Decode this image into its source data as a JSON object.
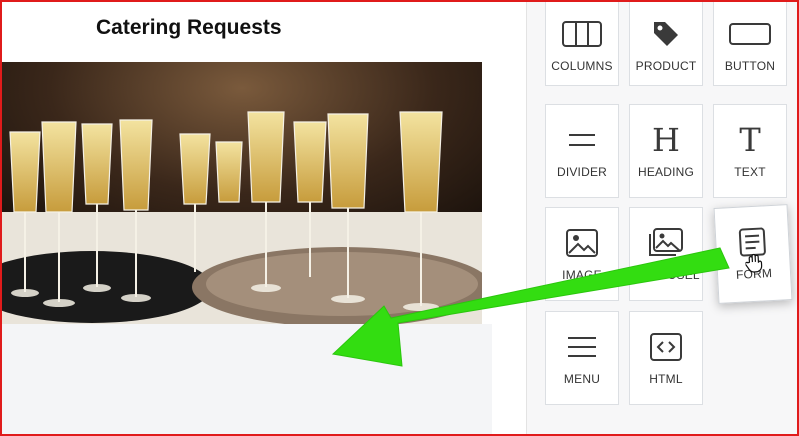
{
  "canvas": {
    "title": "Catering Requests",
    "photo_alt": "Champagne flutes on serving trays"
  },
  "blocks": [
    {
      "label": "COLUMNS",
      "icon": "columns-icon"
    },
    {
      "label": "PRODUCT",
      "icon": "tag-icon"
    },
    {
      "label": "BUTTON",
      "icon": "button-icon"
    },
    {
      "label": "DIVIDER",
      "icon": "divider-icon"
    },
    {
      "label": "HEADING",
      "icon": "heading-icon"
    },
    {
      "label": "TEXT",
      "icon": "text-icon"
    },
    {
      "label": "IMAGE",
      "icon": "image-icon"
    },
    {
      "label": "CAROUSEL",
      "icon": "carousel-icon"
    },
    {
      "label": "MENU",
      "icon": "menu-icon"
    },
    {
      "label": "HTML",
      "icon": "html-icon"
    }
  ],
  "dragging_block": {
    "label": "FORM",
    "icon": "form-icon"
  },
  "colors": {
    "frame": "#e01b1b",
    "arrow": "#33dd11",
    "icon": "#3a3a3a"
  }
}
